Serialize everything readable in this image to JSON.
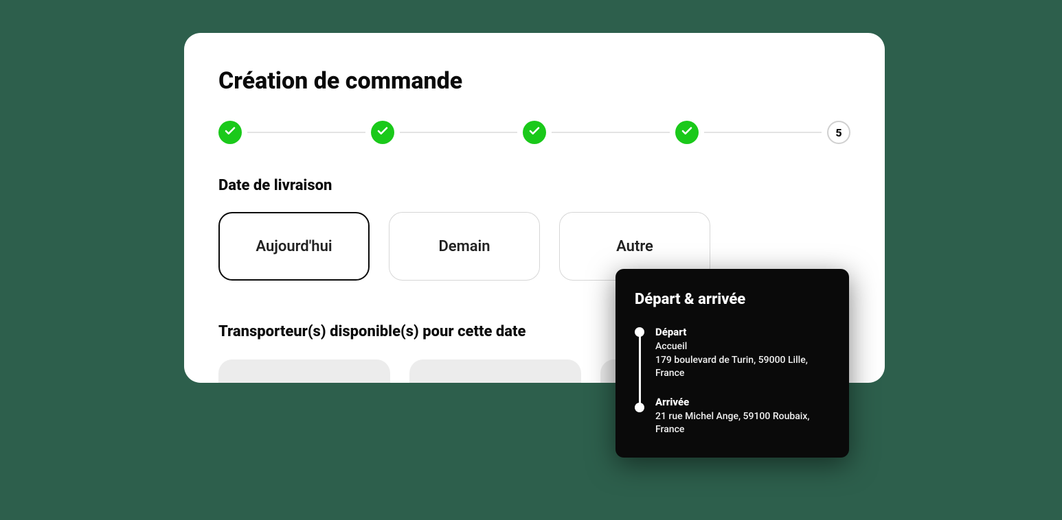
{
  "title": "Création de commande",
  "stepper": {
    "completed_count": 4,
    "final_step_number": "5"
  },
  "date_section": {
    "label": "Date de livraison",
    "options": [
      {
        "label": "Aujourd'hui",
        "selected": true
      },
      {
        "label": "Demain",
        "selected": false
      },
      {
        "label": "Autre",
        "selected": false
      }
    ]
  },
  "carriers_section": {
    "label": "Transporteur(s) disponible(s) pour cette date"
  },
  "popover": {
    "title": "Départ & arrivée",
    "depart": {
      "label": "Départ",
      "name": "Accueil",
      "address": "179 boulevard de Turin, 59000 Lille, France"
    },
    "arrivee": {
      "label": "Arrivée",
      "address": "21 rue Michel Ange, 59100 Roubaix, France"
    }
  }
}
